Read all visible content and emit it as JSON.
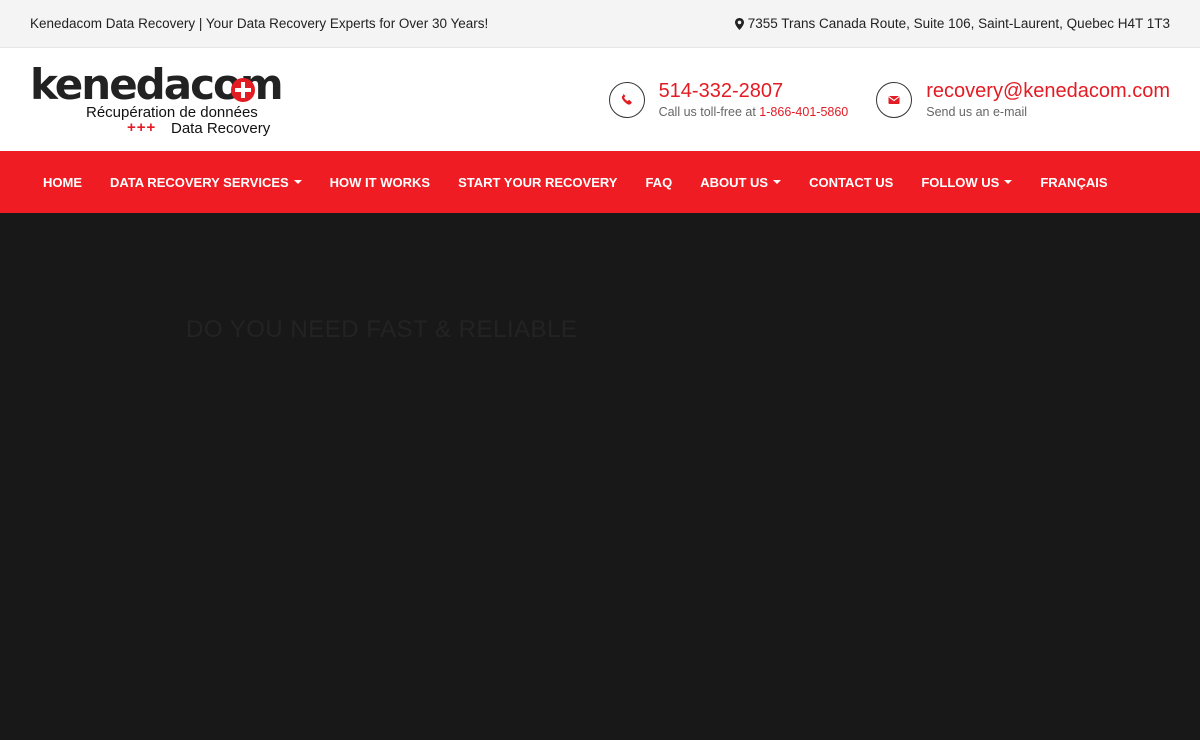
{
  "topbar": {
    "tagline": "Kenedacom Data Recovery | Your Data Recovery Experts for Over 30 Years!",
    "address": "7355 Trans Canada Route, Suite 106, Saint-Laurent, Quebec H4T 1T3",
    "address_icon": "map-marker-icon"
  },
  "logo": {
    "brand": "kenedacom",
    "tagline_fr": "Récupération de données",
    "plus_marks": "+++",
    "tagline_en": "Data Recovery",
    "accent": "#e31b23"
  },
  "contact": {
    "phone": "514-332-2807",
    "phone_sub_prefix": "Call us toll-free at ",
    "toll_free": "1-866-401-5860",
    "phone_icon": "phone-icon",
    "email": "recovery@kenedacom.com",
    "email_sub": "Send us an e-mail",
    "email_icon": "envelope-icon"
  },
  "nav": {
    "background": "#ef1c24",
    "items": [
      {
        "label": "HOME"
      },
      {
        "label": "DATA RECOVERY SERVICES"
      },
      {
        "label": "HOW IT WORKS"
      },
      {
        "label": "START YOUR RECOVERY"
      },
      {
        "label": "FAQ"
      },
      {
        "label": "ABOUT US"
      },
      {
        "label": "CONTACT US"
      },
      {
        "label": "FOLLOW US"
      },
      {
        "label": "FRANÇAIS"
      }
    ]
  },
  "hero": {
    "headline": "DO YOU NEED FAST & RELIABLE"
  }
}
